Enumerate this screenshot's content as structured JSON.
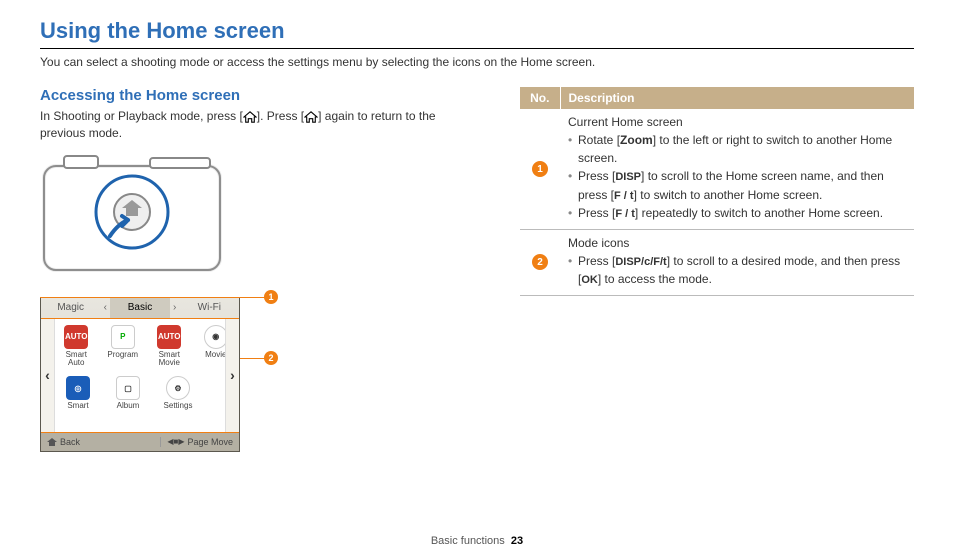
{
  "title": "Using the Home screen",
  "intro": "You can select a shooting mode or access the settings menu by selecting the icons on the Home screen.",
  "section": {
    "heading": "Accessing the Home screen",
    "text_pre": "In Shooting or Playback mode, press [",
    "text_mid": "]. Press [",
    "text_post": "] again to return to the previous mode."
  },
  "screen": {
    "tabs": {
      "left": "Magic",
      "center": "Basic",
      "right": "Wi-Fi"
    },
    "icons": {
      "r1": [
        {
          "label": "Smart Auto",
          "ico": "AUTO"
        },
        {
          "label": "Program",
          "ico": "P"
        },
        {
          "label": "Smart Movie",
          "ico": "AUTO"
        },
        {
          "label": "Movie",
          "ico": ""
        }
      ],
      "r2": [
        {
          "label": "Smart",
          "ico": ""
        },
        {
          "label": "Album",
          "ico": ""
        },
        {
          "label": "Settings",
          "ico": ""
        }
      ]
    },
    "bottom": {
      "back": "Back",
      "pagemove": "Page Move"
    }
  },
  "callouts": {
    "c1": "1",
    "c2": "2"
  },
  "table": {
    "h_no": "No.",
    "h_desc": "Description",
    "rows": [
      {
        "num": "1",
        "title": "Current Home screen",
        "items": [
          {
            "pre": "Rotate [",
            "k": "Zoom",
            "post": "] to the left or right to switch to another Home screen."
          },
          {
            "pre": "Press [",
            "k": "DISP",
            "post": "] to scroll to the Home screen name, and then press [",
            "k2": "F / t",
            "post2": "] to switch to another Home screen."
          },
          {
            "pre": "Press [",
            "k": "F / t",
            "post": "] repeatedly to switch to another Home screen."
          }
        ]
      },
      {
        "num": "2",
        "title": "Mode icons",
        "items": [
          {
            "pre": "Press [",
            "k": "DISP/c/F/t",
            "post": "] to scroll to a desired mode, and then press [",
            "k2": "OK",
            "post2": "] to access the mode."
          }
        ]
      }
    ]
  },
  "footer": {
    "section": "Basic functions",
    "page": "23"
  }
}
